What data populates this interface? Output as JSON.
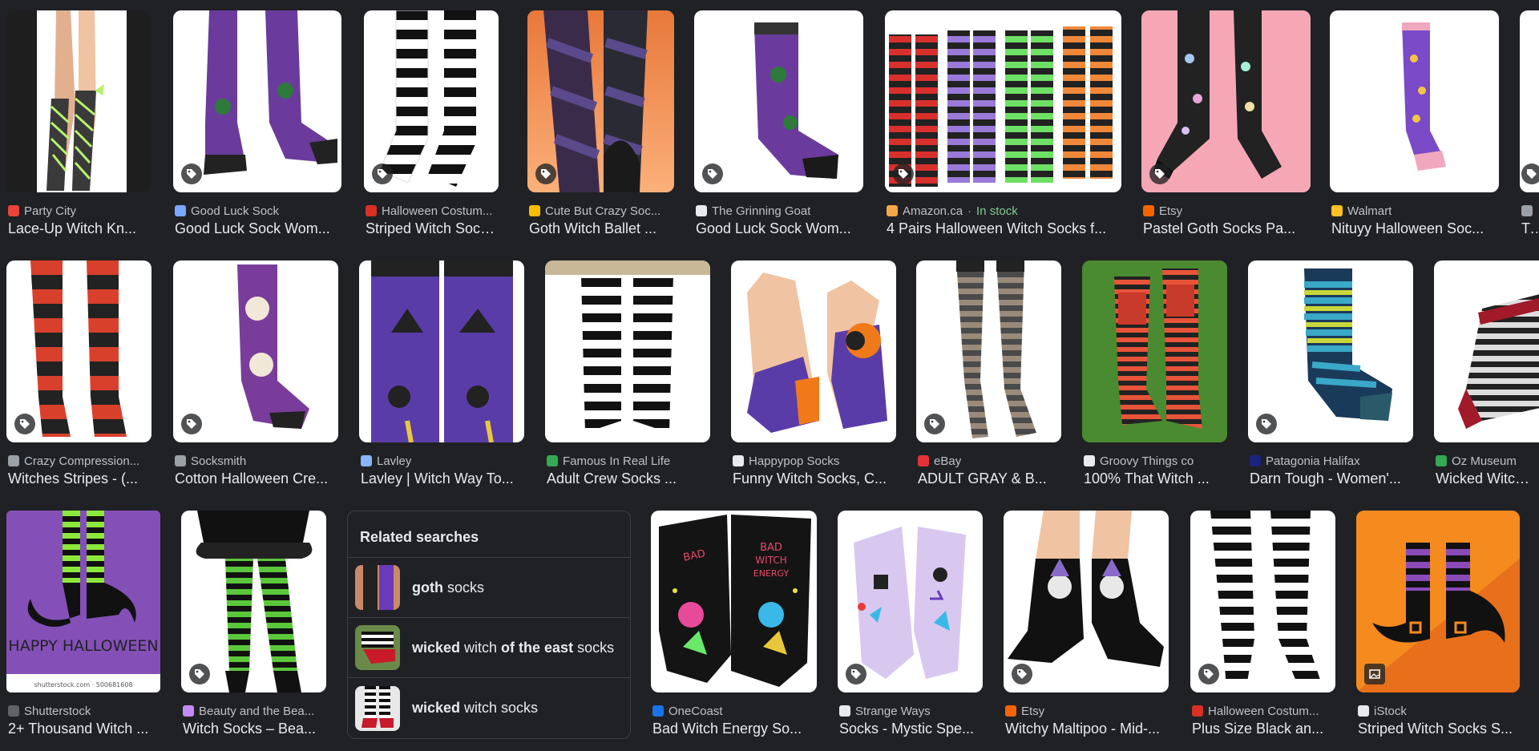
{
  "row1": [
    {
      "source": "Party City",
      "title": "Lace-Up Witch Kn...",
      "tag": false,
      "fav": "#e8443a"
    },
    {
      "source": "Good Luck Sock",
      "title": "Good Luck Sock Wom...",
      "tag": true,
      "fav": "#7aa7ff"
    },
    {
      "source": "Halloween Costum...",
      "title": "Striped Witch Sock...",
      "tag": true,
      "fav": "#d93025"
    },
    {
      "source": "Cute But Crazy Soc...",
      "title": "Goth Witch Ballet ...",
      "tag": true,
      "fav": "#fbbc04"
    },
    {
      "source": "The Grinning Goat",
      "title": "Good Luck Sock Wom...",
      "tag": true,
      "fav": "#e8eaed"
    },
    {
      "source": "Amazon.ca",
      "stock": "In stock",
      "title": "4 Pairs Halloween Witch Socks f...",
      "tag": true,
      "fav": "#f3a847"
    },
    {
      "source": "Etsy",
      "title": "Pastel Goth Socks Pa...",
      "tag": true,
      "fav": "#f56400"
    },
    {
      "source": "Walmart",
      "title": "Nituyy Halloween Soc...",
      "tag": false,
      "fav": "#ffc220"
    },
    {
      "source": "",
      "title": "Tu",
      "tag": true,
      "fav": "#9aa0a6"
    }
  ],
  "row2": [
    {
      "source": "Crazy Compression...",
      "title": "Witches Stripes - (...",
      "tag": true,
      "fav": "#9aa0a6"
    },
    {
      "source": "Socksmith",
      "title": "Cotton Halloween Cre...",
      "tag": true,
      "fav": "#9aa0a6"
    },
    {
      "source": "Lavley",
      "title": "Lavley | Witch Way To...",
      "tag": false,
      "fav": "#8ab4f8"
    },
    {
      "source": "Famous In Real Life",
      "title": "Adult Crew Socks ...",
      "tag": false,
      "fav": "#34a853"
    },
    {
      "source": "Happypop Socks",
      "title": "Funny Witch Socks, C...",
      "tag": false,
      "fav": "#e8eaed"
    },
    {
      "source": "eBay",
      "title": "ADULT GRAY & B...",
      "tag": true,
      "fav": "#e53238"
    },
    {
      "source": "Groovy Things co",
      "title": "100% That Witch ...",
      "tag": false,
      "fav": "#e8eaed"
    },
    {
      "source": "Patagonia Halifax",
      "title": "Darn Tough - Women'...",
      "tag": true,
      "fav": "#1a237e"
    },
    {
      "source": "Oz Museum",
      "title": "Wicked Witch of",
      "tag": false,
      "fav": "#34a853"
    }
  ],
  "row3": [
    {
      "source": "Shutterstock",
      "title": "2+ Thousand Witch ...",
      "tag": false,
      "fav": "#5f6368"
    },
    {
      "source": "Beauty and the Bea...",
      "title": "Witch Socks – Bea...",
      "tag": true,
      "fav": "#c58af9"
    },
    {
      "source": "OneCoast",
      "title": "Bad Witch Energy So...",
      "tag": false,
      "fav": "#1a73e8"
    },
    {
      "source": "Strange Ways",
      "title": "Socks - Mystic Spe...",
      "tag": true,
      "fav": "#e8eaed"
    },
    {
      "source": "Etsy",
      "title": "Witchy Maltipoo - Mid-...",
      "tag": true,
      "fav": "#f56400"
    },
    {
      "source": "Halloween Costum...",
      "title": "Plus Size Black an...",
      "tag": true,
      "fav": "#d93025"
    },
    {
      "source": "iStock",
      "title": "Striped Witch Socks S...",
      "tag": true,
      "fav": "#e8eaed"
    }
  ],
  "related": {
    "heading": "Related searches",
    "items": [
      {
        "bold": "goth",
        "rest": " socks"
      },
      {
        "bold": "wicked",
        "rest": " witch ",
        "bold2": "of the east",
        "rest2": " socks"
      },
      {
        "bold": "wicked",
        "rest": " witch socks"
      }
    ]
  },
  "shutterstock_caption": "HAPPY HALLOWEEN",
  "shutterstock_id": "shutterstock.com · 500681608",
  "sock_text_bad_witch": "BAD WITCH ENERGY"
}
